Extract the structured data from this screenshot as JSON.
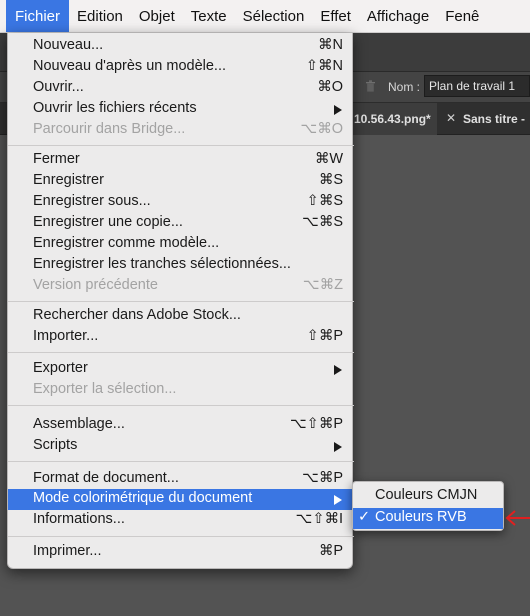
{
  "menubar": {
    "items": [
      {
        "label": "",
        "name": "apple-menu"
      },
      {
        "label": "Fichier",
        "name": "menu-fichier"
      },
      {
        "label": "Edition",
        "name": "menu-edition"
      },
      {
        "label": "Objet",
        "name": "menu-objet"
      },
      {
        "label": "Texte",
        "name": "menu-texte"
      },
      {
        "label": "Sélection",
        "name": "menu-selection"
      },
      {
        "label": "Effet",
        "name": "menu-effet"
      },
      {
        "label": "Affichage",
        "name": "menu-affichage"
      },
      {
        "label": "Fenê",
        "name": "menu-fenetre"
      }
    ]
  },
  "app": {
    "nom_label": "Nom :",
    "nom_value": "Plan de travail 1",
    "tab_active": "10.56.43.png*",
    "tab_close": "✕",
    "tab_other": "Sans titre -"
  },
  "menu": {
    "items": [
      {
        "label": "Nouveau...",
        "shortcut": "⌘N"
      },
      {
        "label": "Nouveau d'après un modèle...",
        "shortcut": "⇧⌘N"
      },
      {
        "label": "Ouvrir...",
        "shortcut": "⌘O"
      },
      {
        "label": "Ouvrir les fichiers récents",
        "shortcut": ""
      },
      {
        "label": "Parcourir dans Bridge...",
        "shortcut": "⌥⌘O"
      },
      {
        "label": "Fermer",
        "shortcut": "⌘W"
      },
      {
        "label": "Enregistrer",
        "shortcut": "⌘S"
      },
      {
        "label": "Enregistrer sous...",
        "shortcut": "⇧⌘S"
      },
      {
        "label": "Enregistrer une copie...",
        "shortcut": "⌥⌘S"
      },
      {
        "label": "Enregistrer comme modèle...",
        "shortcut": ""
      },
      {
        "label": "Enregistrer les tranches sélectionnées...",
        "shortcut": ""
      },
      {
        "label": "Version précédente",
        "shortcut": "⌥⌘Z"
      },
      {
        "label": "Rechercher dans Adobe Stock...",
        "shortcut": ""
      },
      {
        "label": "Importer...",
        "shortcut": "⇧⌘P"
      },
      {
        "label": "Exporter",
        "shortcut": ""
      },
      {
        "label": "Exporter la sélection...",
        "shortcut": ""
      },
      {
        "label": "Assemblage...",
        "shortcut": "⌥⇧⌘P"
      },
      {
        "label": "Scripts",
        "shortcut": ""
      },
      {
        "label": "Format de document...",
        "shortcut": "⌥⌘P"
      },
      {
        "label": "Mode colorimétrique du document",
        "shortcut": ""
      },
      {
        "label": "Informations...",
        "shortcut": "⌥⇧⌘I"
      },
      {
        "label": "Imprimer...",
        "shortcut": "⌘P"
      }
    ]
  },
  "submenu": {
    "items": [
      {
        "label": "Couleurs CMJN",
        "checked": false
      },
      {
        "label": "Couleurs RVB",
        "checked": true,
        "check_mark": "✓"
      }
    ]
  },
  "colors": {
    "accent": "#3a76e3",
    "annotation": "#e02020"
  }
}
